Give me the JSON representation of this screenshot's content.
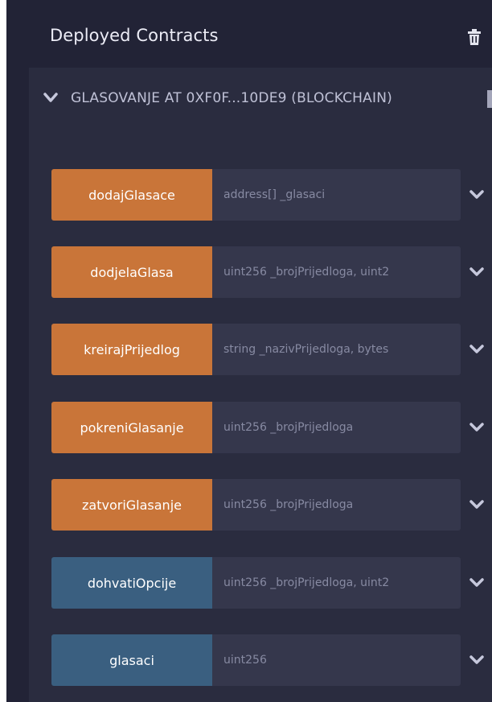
{
  "header": {
    "title": "Deployed Contracts",
    "clear_icon": "trash-icon"
  },
  "instance": {
    "title": "GLASOVANJE AT 0XF0F...10DE9 (BLOCKCHAIN)",
    "toggle_icon": "chevron-down-icon"
  },
  "functions": [
    {
      "label": "dodajGlasace",
      "kind": "transact",
      "placeholder": "address[] _glasaci"
    },
    {
      "label": "dodjelaGlasa",
      "kind": "transact",
      "placeholder": "uint256 _brojPrijedloga, uint2"
    },
    {
      "label": "kreirajPrijedlog",
      "kind": "transact",
      "placeholder": "string _nazivPrijedloga, bytes"
    },
    {
      "label": "pokreniGlasanje",
      "kind": "transact",
      "placeholder": "uint256 _brojPrijedloga"
    },
    {
      "label": "zatvoriGlasanje",
      "kind": "transact",
      "placeholder": "uint256 _brojPrijedloga"
    },
    {
      "label": "dohvatiOpcije",
      "kind": "call",
      "placeholder": "uint256 _brojPrijedloga, uint2"
    },
    {
      "label": "glasaci",
      "kind": "call",
      "placeholder": "uint256"
    }
  ],
  "colors": {
    "panel_bg": "#222336",
    "instance_bg": "#2a2c3f",
    "transact_button": "#c97539",
    "call_button": "#3a5f80",
    "input_bg": "#35374c"
  }
}
